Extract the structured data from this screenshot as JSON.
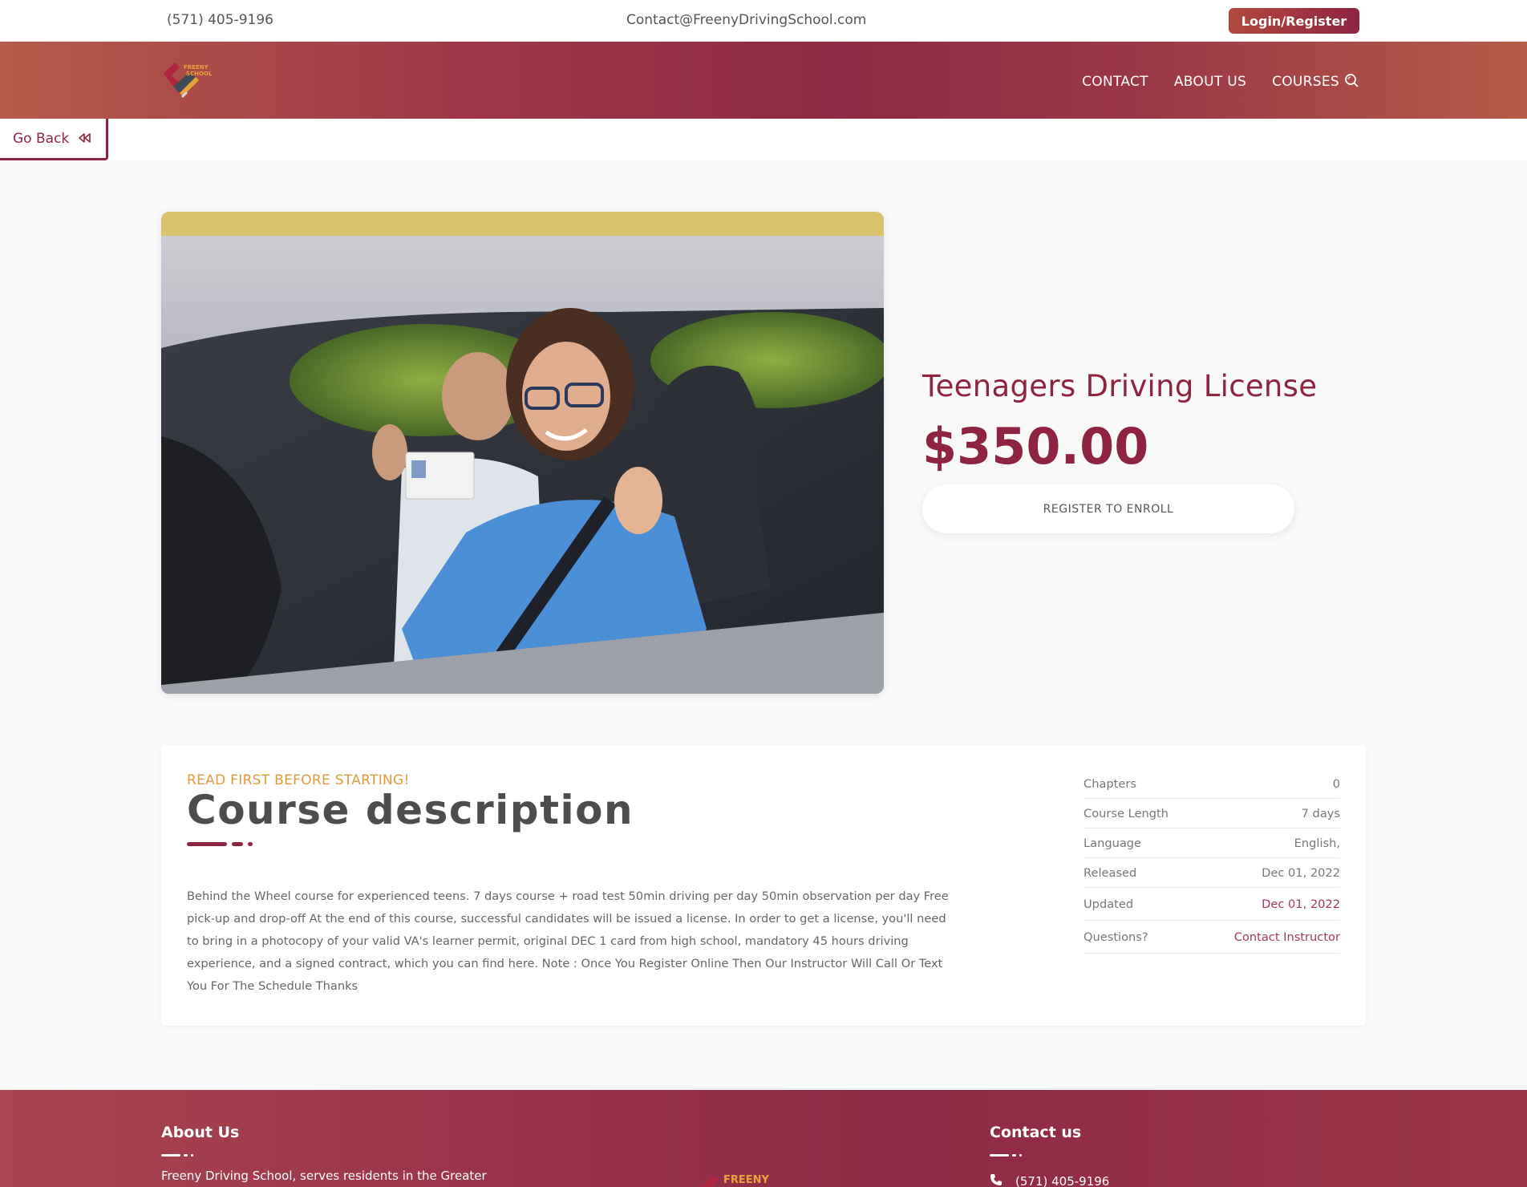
{
  "topbar": {
    "phone": "(571) 405-9196",
    "email": "Contact@FreenyDrivingSchool.com",
    "login_label": "Login/Register"
  },
  "header": {
    "logo_text_top": "FREENY",
    "logo_text_bottom": "SCHOOL",
    "nav": [
      "CONTACT",
      "ABOUT US",
      "COURSES"
    ]
  },
  "go_back_label": "Go Back",
  "course": {
    "title": "Teenagers Driving License",
    "price": "$350.00",
    "register_label": "REGISTER TO ENROLL"
  },
  "description": {
    "eyebrow": "READ FIRST BEFORE STARTING!",
    "title": "Course description",
    "body": "Behind the Wheel course for experienced teens. 7 days course + road test 50min driving per day 50min observation per day Free pick-up and drop-off At the end of this course, successful candidates will be issued a license. In order to get a license, you'll need to bring in a photocopy of your valid VA's learner permit, original DEC 1 card from high school, mandatory 45 hours driving experience, and a signed contract, which you can find here. Note : Once You Register Online Then Our Instructor Will Call Or Text You For The Schedule Thanks"
  },
  "meta": [
    {
      "label": "Chapters",
      "value": "0"
    },
    {
      "label": "Course Length",
      "value": "7 days"
    },
    {
      "label": "Language",
      "value": "English,"
    },
    {
      "label": "Released",
      "value": "Dec 01, 2022"
    },
    {
      "label": "Updated",
      "value": "Dec 01, 2022"
    },
    {
      "label": "Questions?",
      "value": "Contact Instructor"
    }
  ],
  "footer": {
    "about_title": "About Us",
    "about_text": "Freeny Driving School, serves residents in the Greater",
    "contact_title": "Contact us",
    "contact_phone": "(571) 405-9196"
  },
  "colors": {
    "brand": "#8e2441",
    "accent_orange": "#e19a3b"
  }
}
